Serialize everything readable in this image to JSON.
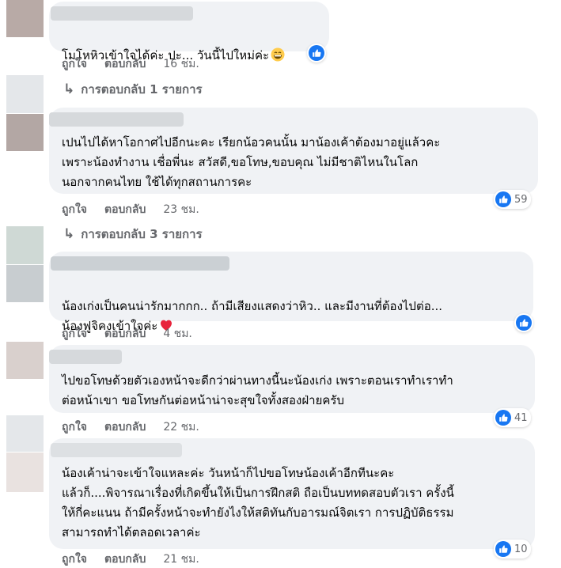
{
  "reply_label_prefix": "↳",
  "comments": [
    {
      "text": "โมโหหิวเข้าใจได้ค่ะ ปะ... วันนี้ไปใหม่ค่ะ",
      "emoji": "grinning-face-emoji",
      "like_label": "ถูกใจ",
      "reply_label": "ตอบกลับ",
      "time": "16 ชม.",
      "reaction_count": "",
      "replies": "การตอบกลับ 1 รายการ"
    },
    {
      "text": "เปนไปได้หาโอกาศไปอีกนะคะ เรียกน้อวคนนั้น มาน้องเค้าต้องมาอยู่แล้วคะ\nเพราะน้องทำงาน เชื่อพี่นะ สวัสดี,ขอโทษ,ขอบคุณ ไม่มีชาติไหนในโลก\nนอกจากคนไทย ใช้ได้ทุกสถานการคะ",
      "like_label": "ถูกใจ",
      "reply_label": "ตอบกลับ",
      "time": "23 ชม.",
      "reaction_count": "59",
      "replies": "การตอบกลับ 3 รายการ"
    },
    {
      "text": "น้องเก่งเป็นคนน่ารักมากกก.. ถ้ามีเสียงแสดงว่าหิว.. และมีงานที่ต้องไปต่อ...\nน้องฟูจิคงเข้าใจค่ะ",
      "emoji": "red-heart-emoji",
      "like_label": "ถูกใจ",
      "reply_label": "ตอบกลับ",
      "time": "4 ชม.",
      "reaction_count": ""
    },
    {
      "text": "ไปขอโทษด้วยตัวเองหน้าจะดีกว่าผ่านทางนี้นะน้องเก่ง เพราะตอนเราทำเราทำ\nต่อหน้าเขา ขอโทษกันต่อหน้าน่าจะสุขใจทั้งสองฝ่ายครับ",
      "like_label": "ถูกใจ",
      "reply_label": "ตอบกลับ",
      "time": "22 ชม.",
      "reaction_count": "41"
    },
    {
      "text": "น้องเค้าน่าจะเข้าใจแหละค่ะ วันหน้าก็ไปขอโทษน้องเค้าอีกทีนะคะ\nแล้วก็....พิจารณาเรื่องที่เกิดขึ้นให้เป็นการฝึกสติ ถือเป็นบททดสอบตัวเรา ครั้งนี้\nให้กี่คะแนน ถ้ามีครั้งหน้าจะทำยังไงให้สติทันกับอารมณ์จิตเรา การปฏิบัติธรรม\nสามารถทำได้ตลอดเวลาค่ะ",
      "like_label": "ถูกใจ",
      "reply_label": "ตอบกลับ",
      "time": "21 ชม.",
      "reaction_count": "10"
    }
  ],
  "colors": {
    "bubble": "#f0f2f5",
    "like_blue": "#1877f2",
    "meta_text": "#65676b"
  }
}
